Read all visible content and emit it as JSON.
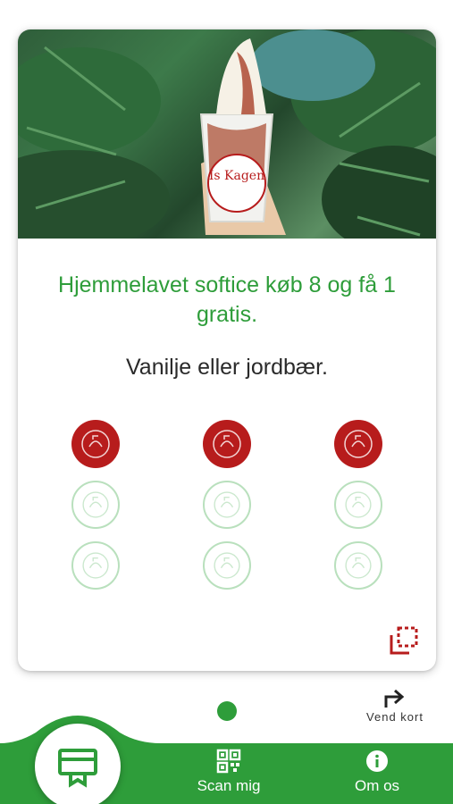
{
  "card": {
    "photo": {
      "alt_badge_text": "Is Kagen"
    },
    "title": "Hjemmelavet softice køb 8 og få 1 gratis.",
    "subtitle": "Vanilje eller jordbær.",
    "stamps": {
      "filled": 3,
      "total": 9
    }
  },
  "pager": {
    "page": 1,
    "count": 1
  },
  "flip": {
    "label": "Vend kort"
  },
  "nav": {
    "card_icon": "loyalty-card-icon",
    "items": [
      {
        "label": "Scan mig",
        "icon": "qr-code-icon"
      },
      {
        "label": "Om os",
        "icon": "info-icon"
      }
    ]
  },
  "colors": {
    "brand_green": "#2e9d3a",
    "stamp_red": "#b71c1c",
    "empty_stamp": "#b9e0bd"
  }
}
